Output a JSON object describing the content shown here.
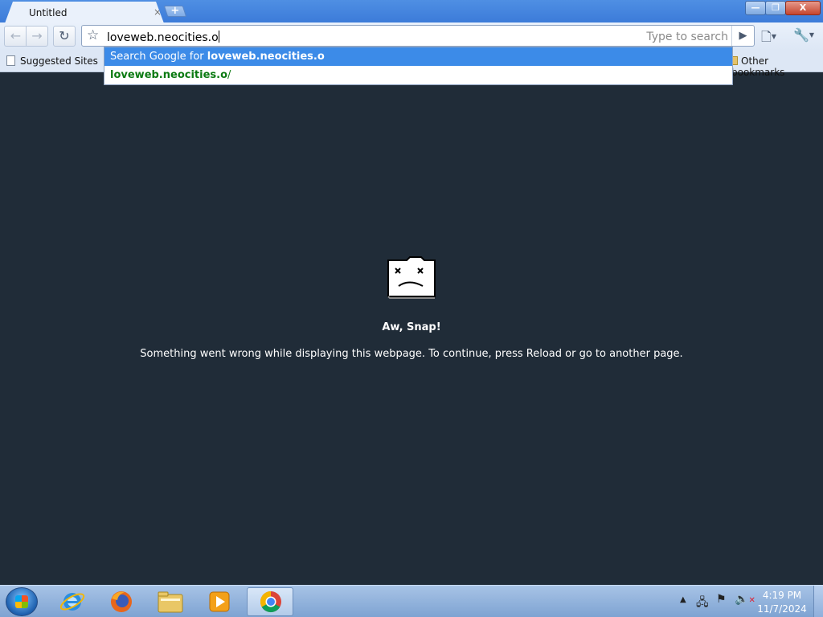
{
  "window": {
    "tab_title": "Untitled",
    "tab_close_glyph": "×",
    "new_tab_glyph": "+",
    "minimize_glyph": "—",
    "maximize_glyph": "❐",
    "close_glyph": "X"
  },
  "toolbar": {
    "back_glyph": "←",
    "forward_glyph": "→",
    "reload_glyph": "↻",
    "star_glyph": "☆",
    "omnibox_value": "loveweb.neocities.o",
    "omnibox_placeholder": "Type to search",
    "go_glyph": "▶",
    "page_menu_glyph": "🗋",
    "wrench_glyph": "🔧"
  },
  "bookmarks": {
    "suggested_sites": "Suggested Sites",
    "other_bookmarks": "Other bookmarks"
  },
  "autocomplete": {
    "search_prefix": "Search Google for ",
    "search_query": "loveweb.neocities.o",
    "url_host": "loveweb.neocities.o",
    "url_path": "/"
  },
  "crash_page": {
    "icon": "sad-folder-icon",
    "title": "Aw, Snap!",
    "message": "Something went wrong while displaying this webpage. To continue, press Reload or go to another page."
  },
  "taskbar": {
    "apps": [
      "internet-explorer",
      "firefox",
      "windows-explorer",
      "windows-media-player",
      "chrome"
    ],
    "active_app": "chrome",
    "tray_arrow": "▲",
    "clock_time": "4:19 PM",
    "clock_date": "11/7/2024"
  },
  "colors": {
    "page_background": "#202c38",
    "autocomplete_highlight": "#3c8be8",
    "url_suggestion": "#0b7a12"
  }
}
